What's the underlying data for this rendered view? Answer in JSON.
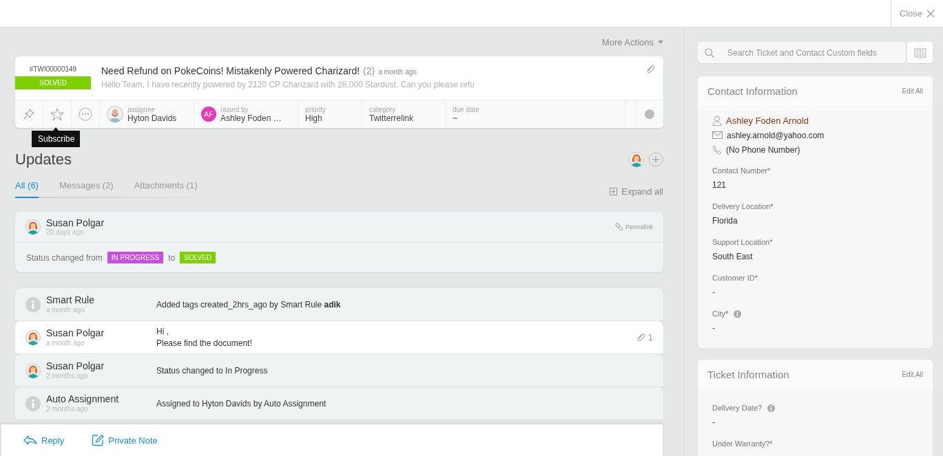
{
  "top_bar": {
    "close_label": "Close"
  },
  "more_actions": "More Actions",
  "ticket": {
    "id": "#TWI00000149",
    "status": {
      "label": "SOLVED",
      "kind": "solved"
    },
    "subject": "Need Refund on PokeCoins! Mistakenly Powered Charizard!",
    "count": "(2)",
    "time": "a month ago",
    "preview": "Hello Team, I have recently powered by 2120 CP Charizard with 28,000 Stardust. Can you please refu",
    "tooltip": "Subscribe",
    "fields": [
      {
        "label": "assignee",
        "value": "Hyton Davids",
        "avatar": {
          "kind": "man"
        }
      },
      {
        "label": "raised by",
        "value": "Ashley Foden …",
        "avatar": {
          "kind": "initials",
          "text": "AF"
        }
      },
      {
        "label": "priority",
        "value": "High"
      },
      {
        "label": "category",
        "value": "Twitterrelink"
      },
      {
        "label": "due date",
        "value": "~"
      }
    ]
  },
  "updates": {
    "title": "Updates",
    "tabs": [
      {
        "label": "All (6)",
        "selected": true
      },
      {
        "label": "Messages (2)",
        "selected": false
      },
      {
        "label": "Attachments (1)",
        "selected": false
      }
    ],
    "expand_all": "Expand all"
  },
  "activity": {
    "author": "Susan Polgar",
    "time": "20 days ago",
    "avatar": {
      "kind": "woman"
    },
    "permalink": "Permalink",
    "text": "Status changed from",
    "from": {
      "label": "IN PROGRESS",
      "kind": "in_progress"
    },
    "joiner": "to",
    "to": {
      "label": "SOLVED",
      "kind": "solved"
    }
  },
  "timeline": [
    {
      "kind": "event",
      "avatar": {
        "kind": "info"
      },
      "author": "Smart Rule",
      "time": "a month ago",
      "lines": [
        "Added tags created_2hrs_ago by Smart Rule **adik**"
      ]
    },
    {
      "kind": "message",
      "avatar": {
        "kind": "woman"
      },
      "author": "Susan Polgar",
      "time": "a month ago",
      "lines": [
        "Hi ,",
        "Please find the document!"
      ],
      "attachments": "1"
    },
    {
      "kind": "event",
      "avatar": {
        "kind": "woman"
      },
      "author": "Susan Polgar",
      "time": "2 months ago",
      "lines": [
        "Status changed to In Progress"
      ]
    },
    {
      "kind": "event",
      "avatar": {
        "kind": "info"
      },
      "author": "Auto Assignment",
      "time": "2 months ago",
      "lines": [
        "Assigned to Hyton Davids by Auto Assignment"
      ]
    }
  ],
  "composer": {
    "actions": [
      {
        "label": "Reply",
        "kind": "reply"
      },
      {
        "label": "Private Note",
        "kind": "note"
      }
    ]
  },
  "sidebar": {
    "search": {
      "placeholder": "Search Ticket and Contact Custom fields"
    },
    "sections": [
      {
        "title": "Contact Information",
        "edit": "Edit All",
        "contact": {
          "name": "Ashley Foden Arnold",
          "email": "ashley.arnold@yahoo.com",
          "phone": "(No Phone Number)"
        },
        "fields": [
          {
            "label": "Contact Number*",
            "value": "121",
            "info": false
          },
          {
            "label": "Delivery Location*",
            "value": "Florida",
            "info": false
          },
          {
            "label": "Support Location*",
            "value": "South East",
            "info": false
          },
          {
            "label": "Customer ID*",
            "value": "-",
            "info": false
          },
          {
            "label": "City*",
            "value": "-",
            "info": true
          }
        ]
      },
      {
        "title": "Ticket Information",
        "edit": "Edit All",
        "fields": [
          {
            "label": "Delivery Date?",
            "value": "-",
            "info": true
          },
          {
            "label": "Under Warranty?*",
            "info": false
          }
        ]
      }
    ]
  }
}
